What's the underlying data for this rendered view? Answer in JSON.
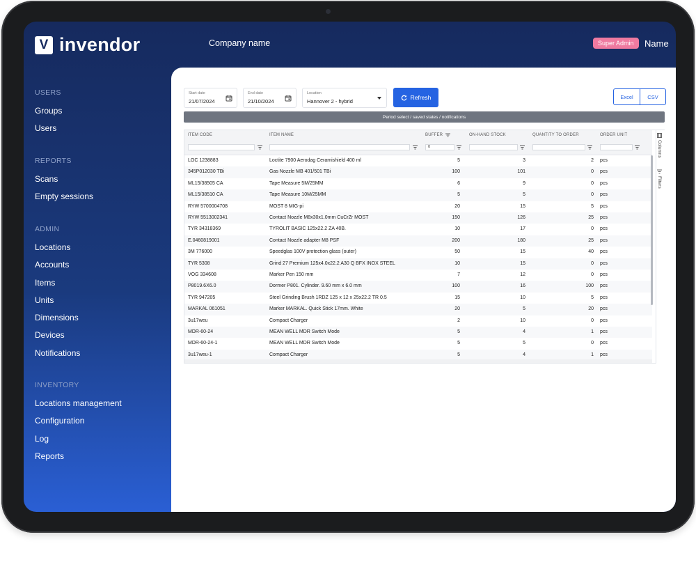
{
  "app": {
    "brand": "invendor",
    "brand_mark": "V",
    "company": "Company name",
    "role_badge": "Super Admin",
    "user_name": "Name"
  },
  "colors": {
    "navy": "#162a5e",
    "accent": "#2563e2",
    "badge": "#ef7aa0",
    "period_bar": "#6f7580"
  },
  "sidebar": {
    "sections": [
      {
        "title": "USERS",
        "items": [
          "Groups",
          "Users"
        ]
      },
      {
        "title": "REPORTS",
        "items": [
          "Scans",
          "Empty sessions"
        ]
      },
      {
        "title": "ADMIN",
        "items": [
          "Locations",
          "Accounts",
          "Items",
          "Units",
          "Dimensions",
          "Devices",
          "Notifications"
        ]
      },
      {
        "title": "INVENTORY",
        "items": [
          "Locations management",
          "Configuration",
          "Log",
          "Reports"
        ]
      }
    ]
  },
  "filters": {
    "start_date": {
      "label": "Start date",
      "value": "21/07/2024",
      "icon": "calendar-icon"
    },
    "end_date": {
      "label": "End date",
      "value": "21/10/2024",
      "icon": "calendar-icon"
    },
    "location": {
      "label": "Location",
      "value": "Hannover 2 - hybrid"
    },
    "refresh_label": "Refresh",
    "export": [
      "Excel",
      "CSV"
    ]
  },
  "period_bar": "Period select / saved states / notifications",
  "grid": {
    "columns": [
      "ITEM CODE",
      "ITEM NAME",
      "BUFFER",
      "ON-HAND STOCK",
      "QUANTITY TO ORDER",
      "ORDER UNIT"
    ],
    "buffer_filter_value": "0",
    "side_tabs": [
      "Columns",
      "Filters"
    ],
    "rows": [
      [
        "LOC 1238883",
        "Loctite 7900 Aerodag Ceramishield 400 ml",
        "5",
        "3",
        "2",
        "pcs"
      ],
      [
        "345P012030 TBi",
        "Gas Nozzle MB 401/501 TBi",
        "100",
        "101",
        "0",
        "pcs"
      ],
      [
        "ML15/38505 CA",
        "Tape Measure 5M/25MM",
        "6",
        "9",
        "0",
        "pcs"
      ],
      [
        "ML15/38510 CA",
        "Tape Measure 10M/25MM",
        "5",
        "5",
        "0",
        "pcs"
      ],
      [
        "RYW 5700004708",
        "MOST 8 MIG-pi",
        "20",
        "15",
        "5",
        "pcs"
      ],
      [
        "RYW 5513002341",
        "Contact Nozzle M8x30x1.0mm CuCrZr MOST",
        "150",
        "126",
        "25",
        "pcs"
      ],
      [
        "TYR 34318369",
        "TYROLIT BASIC 125x22.2 ZA 40B.",
        "10",
        "17",
        "0",
        "pcs"
      ],
      [
        "E.0460819001",
        "Contact Nozzle adapter M8 PSF",
        "200",
        "180",
        "25",
        "pcs"
      ],
      [
        "3M 776000",
        "Speedglas 100V protection glass (outer)",
        "50",
        "15",
        "40",
        "pcs"
      ],
      [
        "TYR 5308",
        "Grind 27 Premium 125x4.0x22.2 A30 Q BFX INOX STEEL",
        "10",
        "15",
        "0",
        "pcs"
      ],
      [
        "VOG 334608",
        "Marker Pen 150 mm",
        "7",
        "12",
        "0",
        "pcs"
      ],
      [
        "P8019.6X6.0",
        "Dormer P801. Cylinder. 9.60 mm x 6.0 mm",
        "100",
        "16",
        "100",
        "pcs"
      ],
      [
        "TYR 947205",
        "Steel Grinding Brush 1RDZ 125 x 12 x 25x22.2 TR 0.5",
        "15",
        "10",
        "5",
        "pcs"
      ],
      [
        "MARKAL 061051",
        "Marker MARKAL. Quick Stick 17mm. White",
        "20",
        "5",
        "20",
        "pcs"
      ],
      [
        "3u17weu",
        "Compact Charger",
        "2",
        "10",
        "0",
        "pcs"
      ],
      [
        "MDR-60-24",
        "MEAN WELL MDR Switch Mode",
        "5",
        "4",
        "1",
        "pcs"
      ],
      [
        "MDR-60-24-1",
        "MEAN WELL MDR Switch Mode",
        "5",
        "5",
        "0",
        "pcs"
      ],
      [
        "3u17weu-1",
        "Compact Charger",
        "5",
        "4",
        "1",
        "pcs"
      ]
    ]
  }
}
